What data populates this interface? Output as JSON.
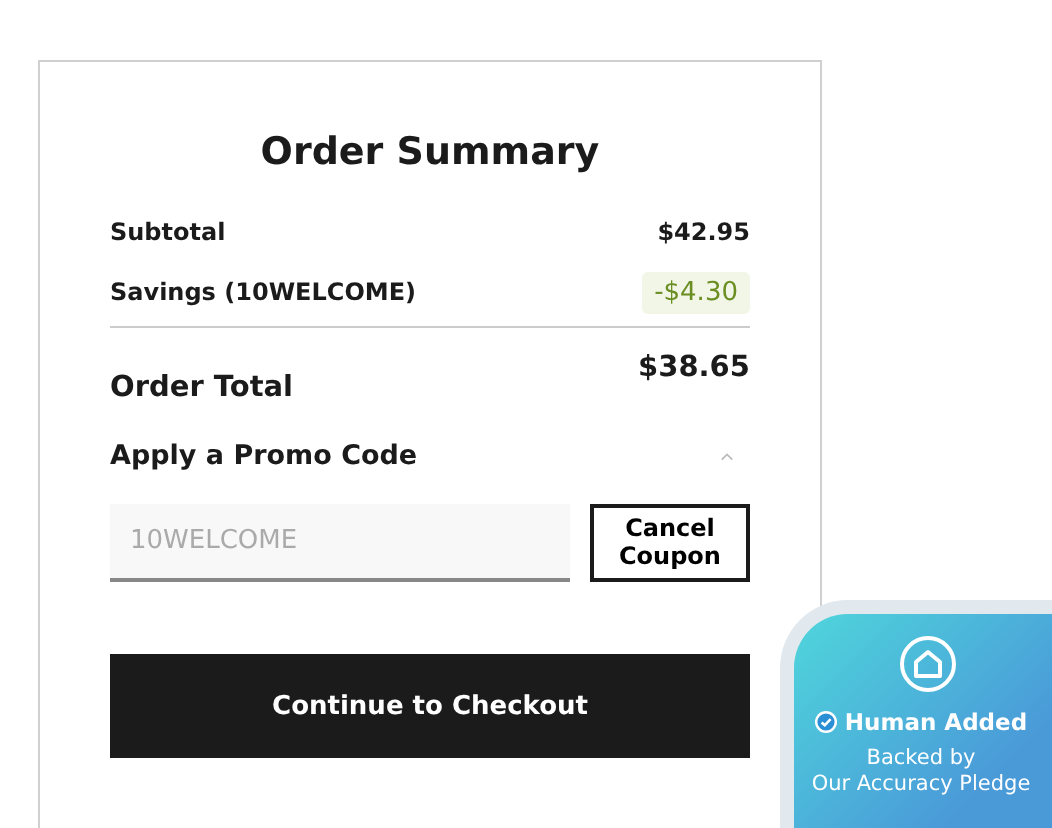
{
  "order_summary": {
    "title": "Order Summary",
    "lines": [
      {
        "label": "Subtotal",
        "value": "$42.95",
        "kind": "plain"
      },
      {
        "label": "Savings (10WELCOME)",
        "value": "-$4.30",
        "kind": "discount"
      }
    ],
    "total": {
      "label": "Order Total",
      "value": "$38.65"
    },
    "promo": {
      "label": "Apply a Promo Code",
      "expanded": true,
      "field": {
        "placeholder": "10WELCOME"
      },
      "button": "Cancel\nCoupon"
    },
    "checkout_button": "Continue to Checkout"
  },
  "badge": {
    "title": "Human Added",
    "subtitle": "Backed by\nOur Accuracy Pledge"
  }
}
